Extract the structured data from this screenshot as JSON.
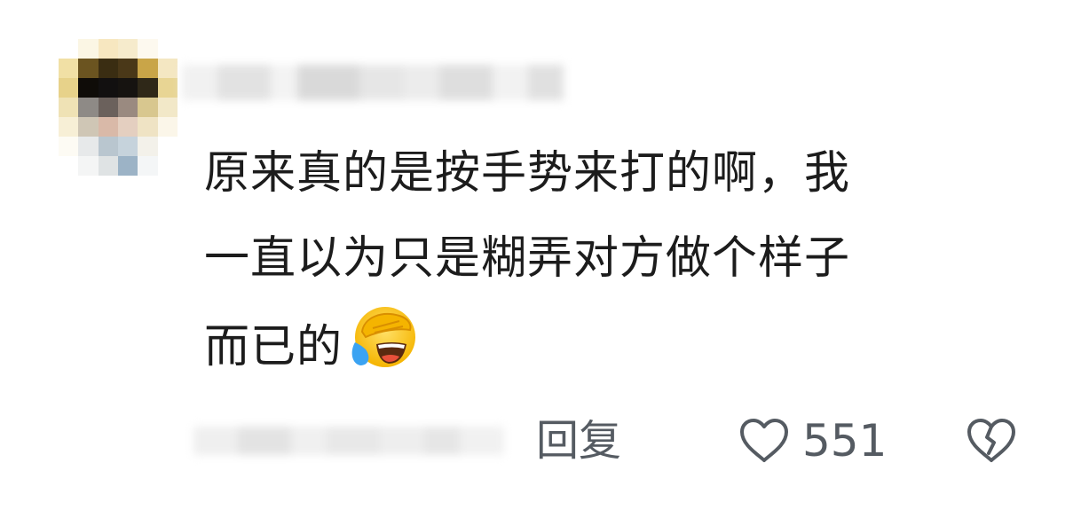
{
  "comment": {
    "text_lines": [
      "原来真的是按手势来打的啊，我",
      "一直以为只是糊弄对方做个样子",
      "而已的"
    ],
    "emoji": "laughing-crying-emoji"
  },
  "actions": {
    "reply_label": "回复",
    "like_count": "551",
    "like_icon": "heart-outline-icon",
    "dislike_icon": "broken-heart-icon"
  },
  "colors": {
    "text": "#1c1c1c",
    "meta": "#555b62"
  }
}
